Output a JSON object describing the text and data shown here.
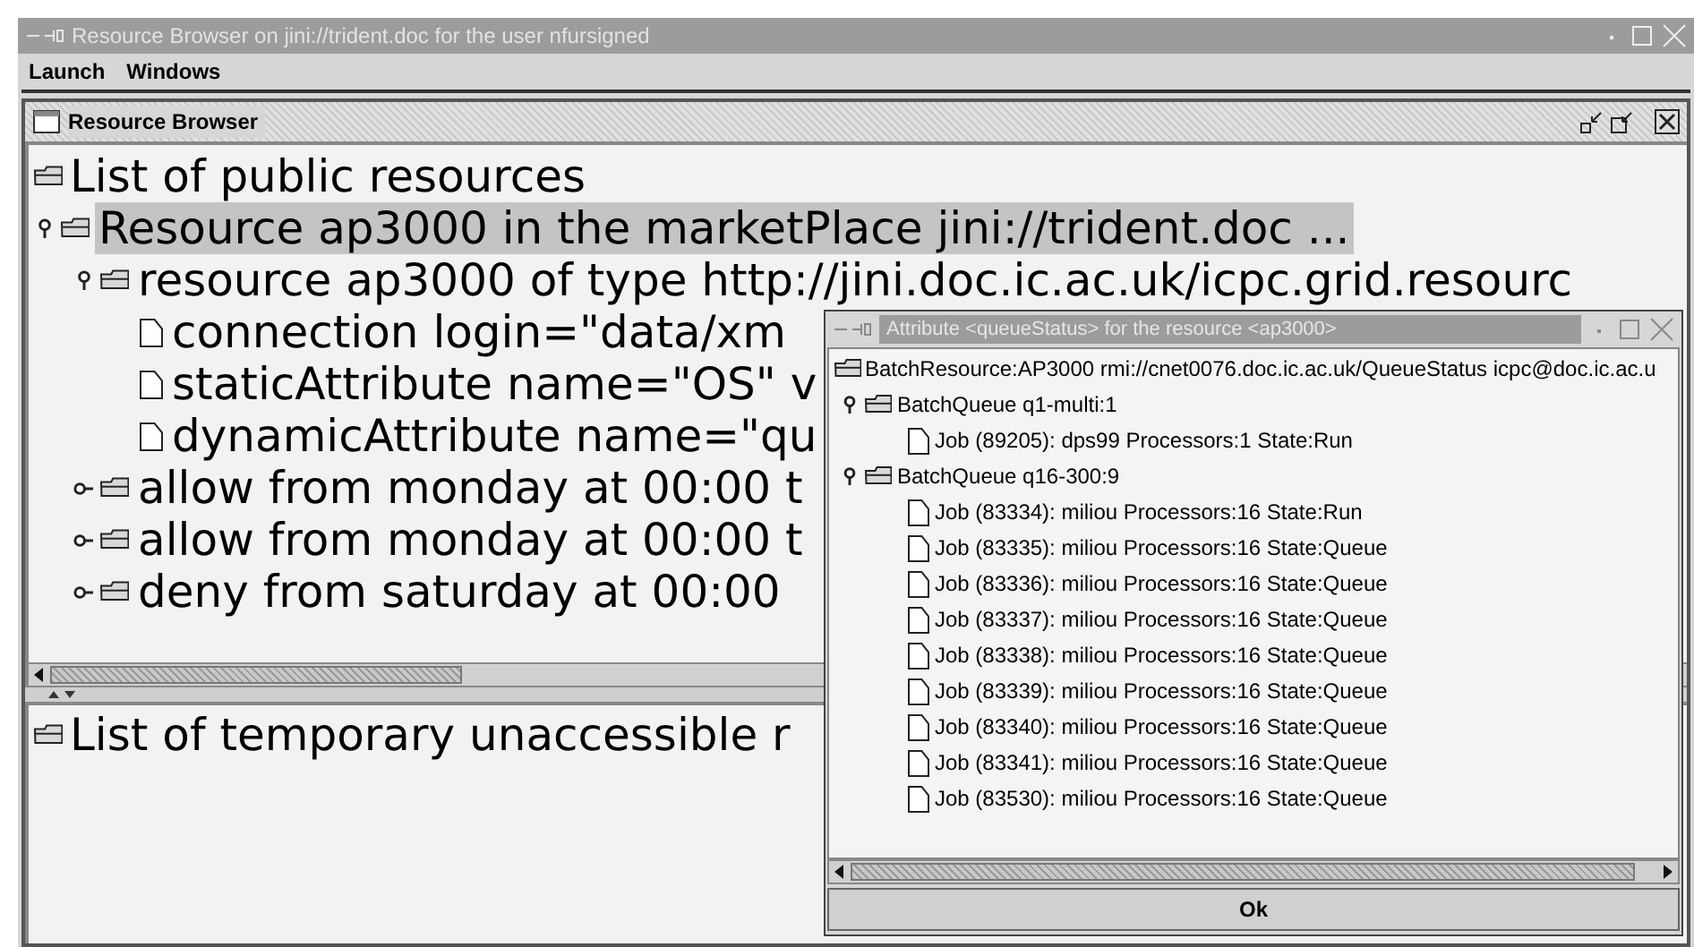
{
  "window": {
    "title": "Resource Browser on jini://trident.doc for the user nfursigned"
  },
  "menu": [
    {
      "label": "Launch"
    },
    {
      "label": "Windows"
    }
  ],
  "internal_frame": {
    "title": "Resource Browser"
  },
  "public_tree": {
    "label": "List of public resources",
    "children": [
      {
        "label": "Resource ap3000 in the marketPlace jini://trident.doc ...",
        "kind": "folder",
        "expanded": true,
        "selected": true,
        "children": [
          {
            "label": "resource ap3000 of type http://jini.doc.ic.ac.uk/icpc.grid.resourc",
            "kind": "folder",
            "expanded": true,
            "selected": false,
            "children": [
              {
                "label": "connection login=\"data/xm",
                "kind": "leaf",
                "selected": false
              },
              {
                "label": "staticAttribute name=\"OS\" v",
                "kind": "leaf",
                "selected": false
              },
              {
                "label": "dynamicAttribute name=\"qu",
                "kind": "leaf",
                "selected": false
              }
            ]
          },
          {
            "label": "allow from monday at 00:00 t",
            "kind": "folder",
            "expanded": false,
            "selected": false
          },
          {
            "label": "allow from monday at 00:00 t",
            "kind": "folder",
            "expanded": false,
            "selected": false
          },
          {
            "label": "deny from saturday at 00:00",
            "kind": "folder",
            "expanded": false,
            "selected": false
          }
        ]
      }
    ]
  },
  "temporary_tree": {
    "label": "List of temporary unaccessible r"
  },
  "dialog": {
    "title": "Attribute <queueStatus> for the resource <ap3000>",
    "tree": {
      "label": "BatchResource:AP3000 rmi://cnet0076.doc.ic.ac.uk/QueueStatus icpc@doc.ic.ac.u",
      "children": [
        {
          "label": "BatchQueue q1-multi:1",
          "kind": "folder",
          "expanded": true,
          "children": [
            {
              "label": "Job (89205): dps99 Processors:1 State:Run",
              "kind": "leaf"
            }
          ]
        },
        {
          "label": "BatchQueue q16-300:9",
          "kind": "folder",
          "expanded": true,
          "children": [
            {
              "label": "Job (83334): miliou Processors:16 State:Run",
              "kind": "leaf"
            },
            {
              "label": "Job (83335): miliou Processors:16 State:Queue",
              "kind": "leaf"
            },
            {
              "label": "Job (83336): miliou Processors:16 State:Queue",
              "kind": "leaf"
            },
            {
              "label": "Job (83337): miliou Processors:16 State:Queue",
              "kind": "leaf"
            },
            {
              "label": "Job (83338): miliou Processors:16 State:Queue",
              "kind": "leaf"
            },
            {
              "label": "Job (83339): miliou Processors:16 State:Queue",
              "kind": "leaf"
            },
            {
              "label": "Job (83340): miliou Processors:16 State:Queue",
              "kind": "leaf"
            },
            {
              "label": "Job (83341): miliou Processors:16 State:Queue",
              "kind": "leaf"
            },
            {
              "label": "Job (83530): miliou Processors:16 State:Queue",
              "kind": "leaf"
            }
          ]
        }
      ]
    },
    "button": "Ok"
  }
}
